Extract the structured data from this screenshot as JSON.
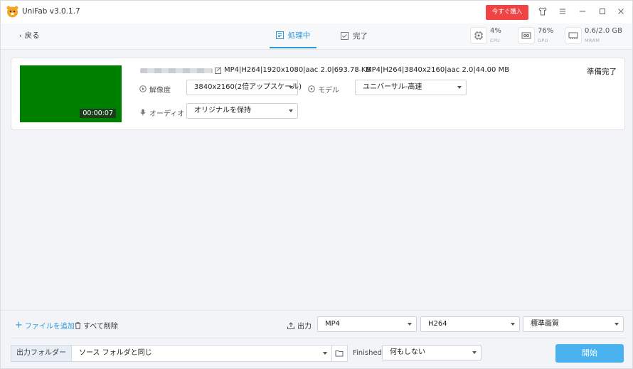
{
  "app": {
    "title": "UniFab v3.0.1.7"
  },
  "titlebar": {
    "buy_label": "今すぐ購入"
  },
  "toolbar": {
    "back_label": "戻る",
    "tabs": [
      {
        "label": "処理中"
      },
      {
        "label": "完了"
      }
    ],
    "stats": [
      {
        "value": "4%",
        "label": "CPU"
      },
      {
        "value": "76%",
        "label": "GPU"
      },
      {
        "value": "0.6/2.0 GB",
        "label": "MRAM"
      }
    ]
  },
  "task": {
    "duration": "00:00:07",
    "source_info": "MP4|H264|1920x1080|aac 2.0|693.78 KB",
    "output_info": "MP4|H264|3840x2160|aac 2.0|44.00 MB",
    "status": "準備完了",
    "resolution_label": "解像度",
    "resolution_value": "3840x2160(2倍アップスケール)",
    "model_label": "モデル",
    "model_value": "ユニバーサル-高速",
    "audio_label": "オーディオ",
    "audio_value": "オリジナルを保持"
  },
  "bottom": {
    "add_file_label": "ファイルを追加",
    "delete_all_label": "すべて削除",
    "output_label": "出力",
    "format_value": "MP4",
    "codec_value": "H264",
    "quality_value": "標準画質",
    "output_folder_label": "出力フォルダー",
    "output_folder_value": "ソース フォルダと同じ",
    "finished_label": "Finished",
    "finished_value": "何もしない",
    "start_label": "開始"
  },
  "colors": {
    "accent": "#2a98d8",
    "buy": "#f04344",
    "start": "#4ab2ef",
    "thumbnail": "#008000"
  }
}
